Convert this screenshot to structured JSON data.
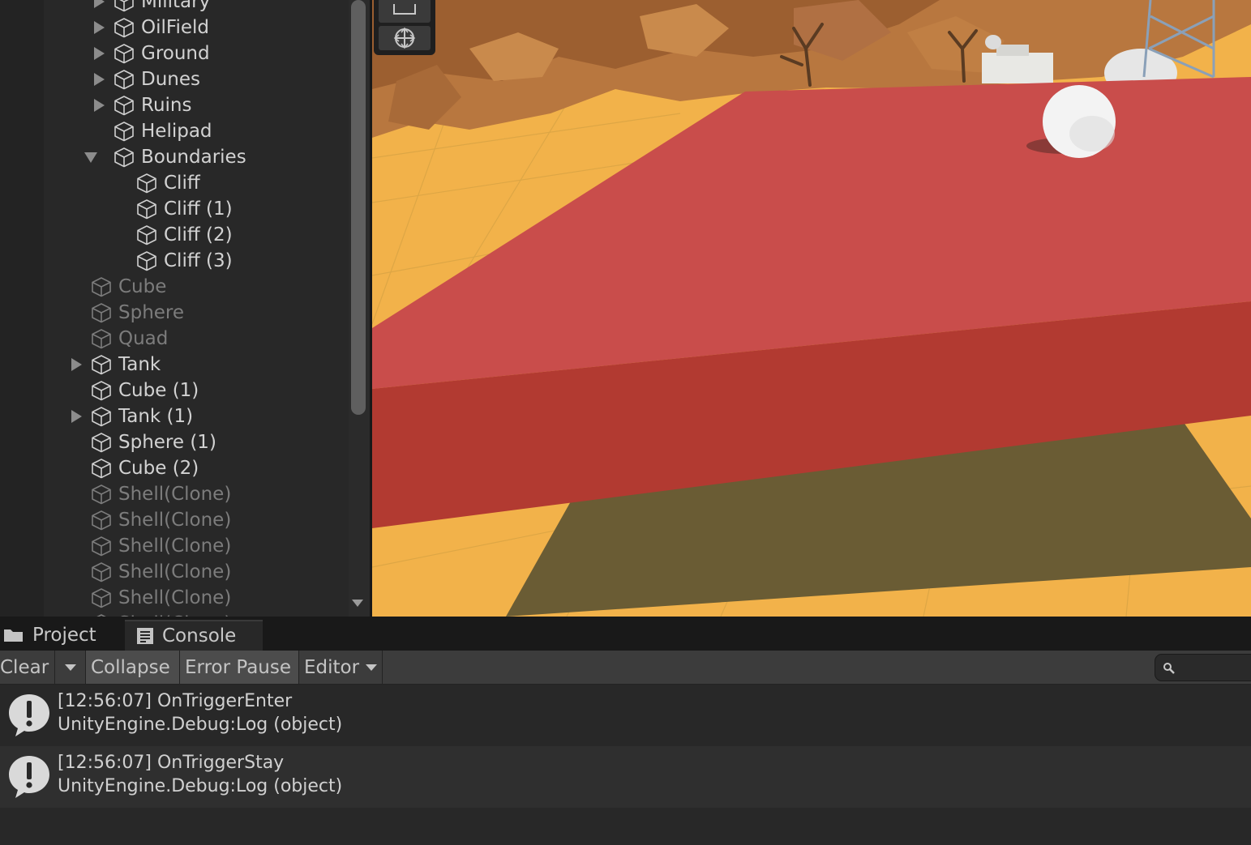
{
  "hierarchy": {
    "items": [
      {
        "label": "Military",
        "expand": "collapsed",
        "indent": 1,
        "dim": false
      },
      {
        "label": "OilField",
        "expand": "collapsed",
        "indent": 1,
        "dim": false
      },
      {
        "label": "Ground",
        "expand": "collapsed",
        "indent": 1,
        "dim": false
      },
      {
        "label": "Dunes",
        "expand": "collapsed",
        "indent": 1,
        "dim": false
      },
      {
        "label": "Ruins",
        "expand": "collapsed",
        "indent": 1,
        "dim": false
      },
      {
        "label": "Helipad",
        "expand": "none",
        "indent": 1,
        "dim": false
      },
      {
        "label": "Boundaries",
        "expand": "expanded",
        "indent": 1,
        "dim": false
      },
      {
        "label": "Cliff",
        "expand": "none",
        "indent": 2,
        "dim": false
      },
      {
        "label": "Cliff (1)",
        "expand": "none",
        "indent": 2,
        "dim": false
      },
      {
        "label": "Cliff (2)",
        "expand": "none",
        "indent": 2,
        "dim": false
      },
      {
        "label": "Cliff (3)",
        "expand": "none",
        "indent": 2,
        "dim": false
      },
      {
        "label": "Cube",
        "expand": "none",
        "indent": 0,
        "dim": true
      },
      {
        "label": "Sphere",
        "expand": "none",
        "indent": 0,
        "dim": true
      },
      {
        "label": "Quad",
        "expand": "none",
        "indent": 0,
        "dim": true
      },
      {
        "label": "Tank",
        "expand": "collapsed",
        "indent": 0,
        "dim": false
      },
      {
        "label": "Cube (1)",
        "expand": "none",
        "indent": 0,
        "dim": false
      },
      {
        "label": "Tank (1)",
        "expand": "collapsed",
        "indent": 0,
        "dim": false
      },
      {
        "label": "Sphere (1)",
        "expand": "none",
        "indent": 0,
        "dim": false
      },
      {
        "label": "Cube (2)",
        "expand": "none",
        "indent": 0,
        "dim": false
      },
      {
        "label": "Shell(Clone)",
        "expand": "none",
        "indent": 0,
        "dim": true
      },
      {
        "label": "Shell(Clone)",
        "expand": "none",
        "indent": 0,
        "dim": true
      },
      {
        "label": "Shell(Clone)",
        "expand": "none",
        "indent": 0,
        "dim": true
      },
      {
        "label": "Shell(Clone)",
        "expand": "none",
        "indent": 0,
        "dim": true
      },
      {
        "label": "Shell(Clone)",
        "expand": "none",
        "indent": 0,
        "dim": true
      },
      {
        "label": "Shell(Clone)",
        "expand": "none",
        "indent": 0,
        "dim": true
      }
    ]
  },
  "tabs": {
    "project": {
      "label": "Project",
      "icon": "folder-icon"
    },
    "console": {
      "label": "Console",
      "icon": "console-icon"
    }
  },
  "toolbar": {
    "clear": "Clear",
    "collapse": "Collapse",
    "error_pause": "Error Pause",
    "editor": "Editor"
  },
  "search": {
    "placeholder": "",
    "icon": "search-icon"
  },
  "console": {
    "entries": [
      {
        "line1": "[12:56:07] OnTriggerEnter",
        "line2": "UnityEngine.Debug:Log (object)",
        "icon": "info-icon"
      },
      {
        "line1": "[12:56:07] OnTriggerStay",
        "line2": "UnityEngine.Debug:Log (object)",
        "icon": "info-icon"
      }
    ]
  },
  "colors": {
    "panel_bg": "#282828",
    "toolbar_bg": "#3c3c3c",
    "sand": "#f2b24a",
    "cube_red": "#c94a48"
  }
}
